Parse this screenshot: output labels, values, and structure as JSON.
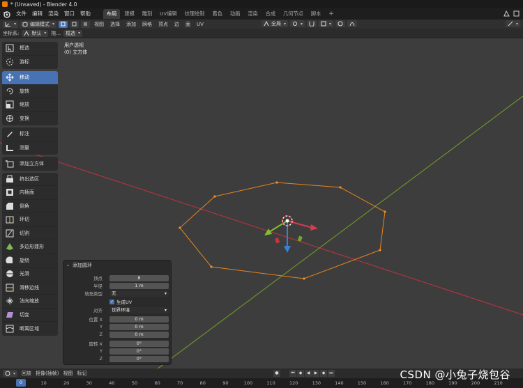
{
  "window": {
    "title": "* (Unsaved) - Blender 4.0"
  },
  "menubar": {
    "items": [
      "文件",
      "编辑",
      "渲染",
      "窗口",
      "帮助"
    ],
    "workspace_tabs": [
      "布局",
      "建模",
      "雕刻",
      "UV编辑",
      "纹理绘制",
      "着色",
      "动画",
      "渲染",
      "合成",
      "几何节点",
      "脚本"
    ],
    "active_tab": "布局",
    "add_tab": "+"
  },
  "viewport_header": {
    "mode": "编辑模式",
    "menus": [
      "视图",
      "选择",
      "添加",
      "网格",
      "顶点",
      "边",
      "面",
      "UV"
    ],
    "transform_orientation": "全局"
  },
  "tool_header": {
    "coord_label": "坐标系:",
    "coord_value": "默认",
    "drag_label": "拖...",
    "select_mode": "框选"
  },
  "viewport_info": {
    "view_name": "用户透视",
    "object_name": "(0) 立方体"
  },
  "toolbar": {
    "groups": [
      [
        {
          "label": "框选",
          "icon": "select-box-icon"
        },
        {
          "label": "游标",
          "icon": "cursor-icon"
        }
      ],
      [
        {
          "label": "移动",
          "icon": "move-icon",
          "active": true
        },
        {
          "label": "旋转",
          "icon": "rotate-icon"
        },
        {
          "label": "缩放",
          "icon": "scale-icon"
        },
        {
          "label": "变换",
          "icon": "transform-icon"
        }
      ],
      [
        {
          "label": "标注",
          "icon": "annotate-icon"
        },
        {
          "label": "测量",
          "icon": "measure-icon"
        }
      ],
      [
        {
          "label": "添加立方体",
          "icon": "add-cube-icon"
        }
      ],
      [
        {
          "label": "挤出选区",
          "icon": "extrude-icon"
        },
        {
          "label": "内插面",
          "icon": "inset-icon"
        },
        {
          "label": "倒角",
          "icon": "bevel-icon"
        },
        {
          "label": "环切",
          "icon": "loop-cut-icon"
        },
        {
          "label": "切割",
          "icon": "knife-icon"
        },
        {
          "label": "多边形建形",
          "icon": "poly-build-icon"
        },
        {
          "label": "旋绕",
          "icon": "spin-icon"
        },
        {
          "label": "光滑",
          "icon": "smooth-icon"
        },
        {
          "label": "滑移边线",
          "icon": "edge-slide-icon"
        },
        {
          "label": "法向缩放",
          "icon": "shrink-fatten-icon"
        },
        {
          "label": "切变",
          "icon": "shear-icon"
        },
        {
          "label": "断离区域",
          "icon": "rip-region-icon"
        }
      ]
    ]
  },
  "operator_panel": {
    "title": "添加圆环",
    "vertices_label": "顶点",
    "vertices_value": "8",
    "radius_label": "半径",
    "radius_value": "1 m",
    "fill_label": "填充类型",
    "fill_value": "无",
    "gen_uv_label": "生成UV",
    "gen_uv_checked": true,
    "align_label": "对齐",
    "align_value": "世界环境",
    "location_label": "位置 X",
    "location": [
      {
        "axis": "位置 X",
        "value": "0 m"
      },
      {
        "axis": "Y",
        "value": "0 m"
      },
      {
        "axis": "Z",
        "value": "0 m"
      }
    ],
    "rotation": [
      {
        "axis": "旋转 X",
        "value": "0°"
      },
      {
        "axis": "Y",
        "value": "0°"
      },
      {
        "axis": "Z",
        "value": "0°"
      }
    ]
  },
  "timeline": {
    "menus": [
      "回放",
      "抠像(插帧)",
      "视图",
      "标记"
    ],
    "current_frame": "0",
    "ticks": [
      "0",
      "10",
      "20",
      "30",
      "40",
      "50",
      "60",
      "70",
      "80",
      "90",
      "100",
      "110",
      "120",
      "130",
      "140",
      "150",
      "160",
      "170",
      "180",
      "190",
      "200",
      "210"
    ]
  },
  "watermark": "CSDN @小兔子烧包谷",
  "colors": {
    "accent": "#4772b3",
    "x_axis": "#b8333f",
    "y_axis": "#6f9a2a",
    "selection": "#e8851e",
    "viewport_bg": "#3d3d3d"
  }
}
